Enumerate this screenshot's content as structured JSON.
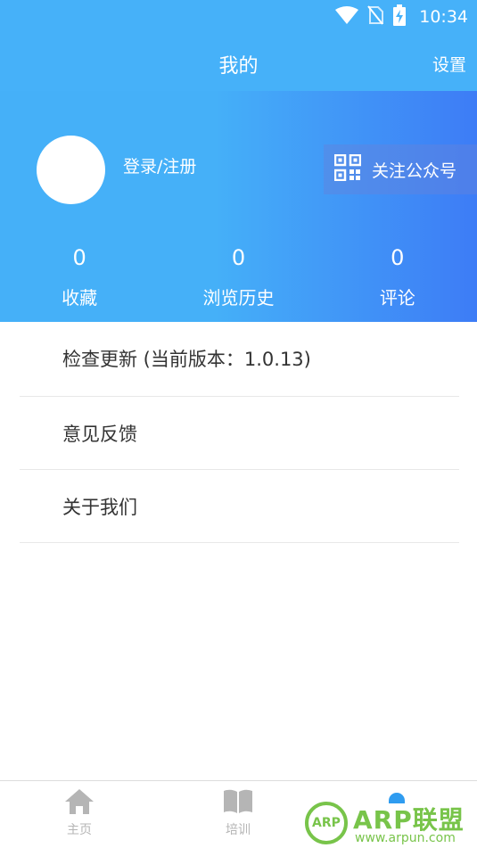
{
  "status_bar": {
    "time": "10:34",
    "icons": [
      "wifi-icon",
      "no-sim-icon",
      "battery-charging-icon"
    ]
  },
  "header": {
    "title": "我的",
    "settings_label": "设置"
  },
  "profile": {
    "login_label": "登录/注册",
    "follow_label": "关注公众号",
    "stats": [
      {
        "count": "0",
        "label": "收藏"
      },
      {
        "count": "0",
        "label": "浏览历史"
      },
      {
        "count": "0",
        "label": "评论"
      }
    ]
  },
  "menu": [
    {
      "label": "检查更新 (当前版本：1.0.13)"
    },
    {
      "label": "意见反馈"
    },
    {
      "label": "关于我们"
    }
  ],
  "bottom_nav": [
    {
      "label": "主页",
      "icon": "home-icon"
    },
    {
      "label": "培训",
      "icon": "book-icon"
    },
    {
      "label": "",
      "icon": "profile-icon",
      "active": true
    }
  ],
  "watermark": {
    "badge": "ARP",
    "title": "ARP联盟",
    "url": "www.arpun.com"
  },
  "colors": {
    "header_blue": "#46b1f9",
    "gradient_end": "#3d7cf6",
    "watermark_green": "#78c44a",
    "inactive_nav": "#b5b5b5"
  }
}
